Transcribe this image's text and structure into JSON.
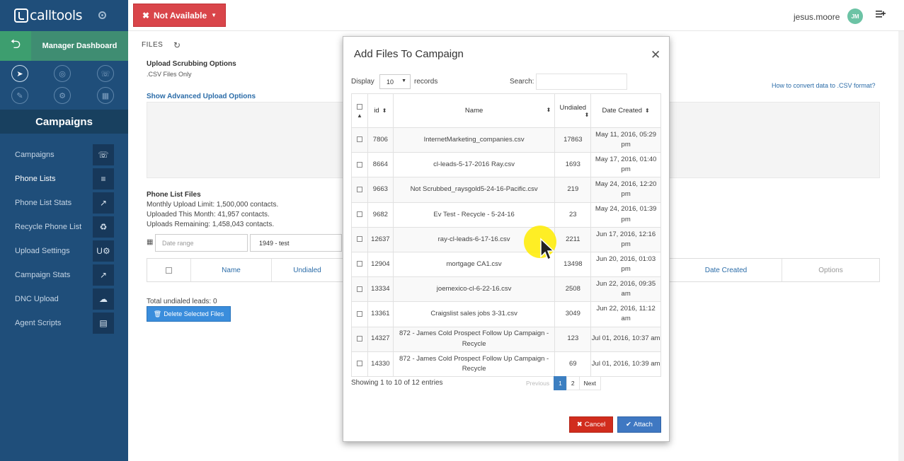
{
  "brand": {
    "logo_text": "calltools"
  },
  "sidebar": {
    "manager_label": "Manager Dashboard",
    "section_title": "Campaigns",
    "items": [
      {
        "label": "Campaigns",
        "icon": "phone-icon",
        "glyph": "☏"
      },
      {
        "label": "Phone Lists",
        "icon": "list-icon",
        "glyph": "≡"
      },
      {
        "label": "Phone List Stats",
        "icon": "trend-icon",
        "glyph": "↗"
      },
      {
        "label": "Recycle Phone List",
        "icon": "recycle-icon",
        "glyph": "♻"
      },
      {
        "label": "Upload Settings",
        "icon": "upload-gear-icon",
        "glyph": "U⚙"
      },
      {
        "label": "Campaign Stats",
        "icon": "stats-icon",
        "glyph": "↗"
      },
      {
        "label": "DNC Upload",
        "icon": "cloud-upload-icon",
        "glyph": "☁"
      },
      {
        "label": "Agent Scripts",
        "icon": "chat-icon",
        "glyph": "▤"
      }
    ]
  },
  "topbar": {
    "status_label": "Not Available",
    "username": "jesus.moore",
    "avatar_initials": "JM"
  },
  "main": {
    "files_label": "FILES",
    "scrub_title": "Upload Scrubbing Options",
    "scrub_sub": ".CSV Files Only",
    "advanced_link": "Show Advanced Upload Options",
    "csv_help_link": "How to convert data to .CSV format?",
    "plf_title": "Phone List Files",
    "monthly_limit": "Monthly Upload Limit: 1,500,000 contacts.",
    "uploaded_month": "Uploaded This Month: 41,957 contacts.",
    "uploads_remaining": "Uploads Remaining: 1,458,043 contacts.",
    "date_placeholder": "Date range",
    "campaign_value": "1949 - test",
    "bg_headers": {
      "name": "Name",
      "undialed": "Undialed",
      "date_created": "Date Created",
      "options": "Options"
    },
    "total_undialed": "Total undialed leads: 0",
    "delete_label": "Delete Selected Files"
  },
  "modal": {
    "title": "Add Files To Campaign",
    "display_label": "Display",
    "display_value": "10",
    "records_label": "records",
    "search_label": "Search:",
    "headers": {
      "id": "id",
      "name": "Name",
      "undialed": "Undialed",
      "date_created": "Date Created"
    },
    "rows": [
      {
        "id": "7806",
        "name": "InternetMarketing_companies.csv",
        "undialed": "17863",
        "date": "May 11, 2016, 05:29 pm"
      },
      {
        "id": "8664",
        "name": "cl-leads-5-17-2016 Ray.csv",
        "undialed": "1693",
        "date": "May 17, 2016, 01:40 pm"
      },
      {
        "id": "9663",
        "name": "Not Scrubbed_raysgold5-24-16-Pacific.csv",
        "undialed": "219",
        "date": "May 24, 2016, 12:20 pm"
      },
      {
        "id": "9682",
        "name": "Ev Test - Recycle - 5-24-16",
        "undialed": "23",
        "date": "May 24, 2016, 01:39 pm"
      },
      {
        "id": "12637",
        "name": "ray-cl-leads-6-17-16.csv",
        "undialed": "2211",
        "date": "Jun 17, 2016, 12:16 pm"
      },
      {
        "id": "12904",
        "name": "mortgage CA1.csv",
        "undialed": "13498",
        "date": "Jun 20, 2016, 01:03 pm"
      },
      {
        "id": "13334",
        "name": "joemexico-cl-6-22-16.csv",
        "undialed": "2508",
        "date": "Jun 22, 2016, 09:35 am"
      },
      {
        "id": "13361",
        "name": "Craigslist sales jobs 3-31.csv",
        "undialed": "3049",
        "date": "Jun 22, 2016, 11:12 am"
      },
      {
        "id": "14327",
        "name": "872 - James Cold Prospect Follow Up Campaign - Recycle",
        "undialed": "123",
        "date": "Jul 01, 2016, 10:37 am"
      },
      {
        "id": "14330",
        "name": "872 - James Cold Prospect Follow Up Campaign - Recycle",
        "undialed": "69",
        "date": "Jul 01, 2016, 10:39 am"
      }
    ],
    "showing": "Showing 1 to 10 of 12 entries",
    "pagination": {
      "previous": "Previous",
      "page1": "1",
      "page2": "2",
      "next": "Next"
    },
    "cancel_label": "Cancel",
    "attach_label": "Attach"
  }
}
